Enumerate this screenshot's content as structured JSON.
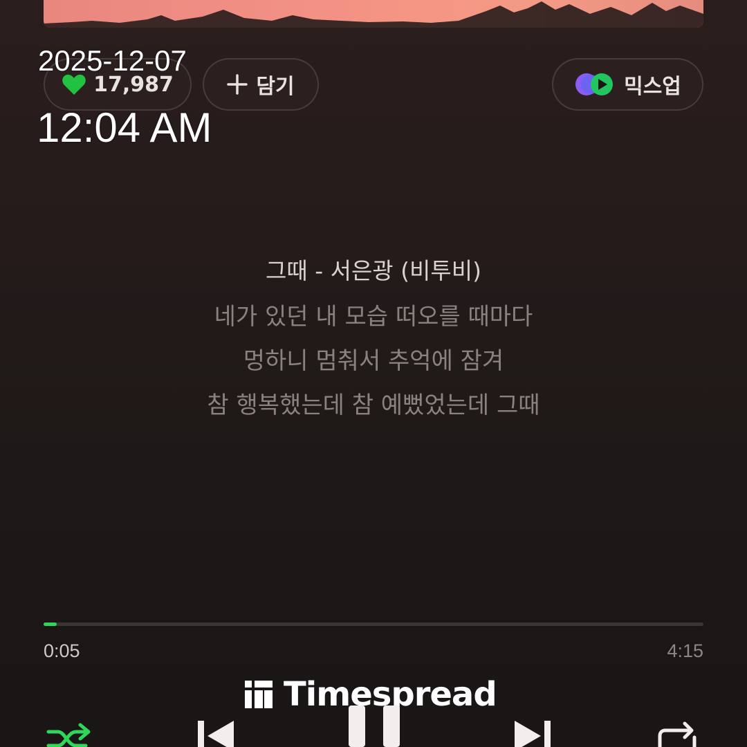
{
  "overlay": {
    "date": "2025-12-07",
    "time": "12:04 AM"
  },
  "actions": {
    "like_count": "17,987",
    "add_label": "담기",
    "mixup_label": "믹스업"
  },
  "lyrics": {
    "title": "그때 - 서은광 (비투비)",
    "lines": [
      "네가 있던 내 모습 떠오를 때마다",
      "멍하니 멈춰서 추억에 잠겨",
      "참 행복했는데 참 예뻤었는데 그때"
    ]
  },
  "playback": {
    "elapsed": "0:05",
    "total": "4:15",
    "progress_fraction": 0.02,
    "state": "playing"
  },
  "watermark": {
    "text": "Timespread"
  },
  "colors": {
    "accent": "#2ed65a",
    "like_heart": "#22c13f",
    "background": "#1d1716"
  },
  "icons": {
    "like": "heart-icon",
    "add": "plus-icon",
    "mixup": "mixup-logo-icon",
    "shuffle": "shuffle-icon",
    "previous": "previous-icon",
    "pause": "pause-icon",
    "next": "next-icon",
    "repeat": "repeat-icon"
  }
}
